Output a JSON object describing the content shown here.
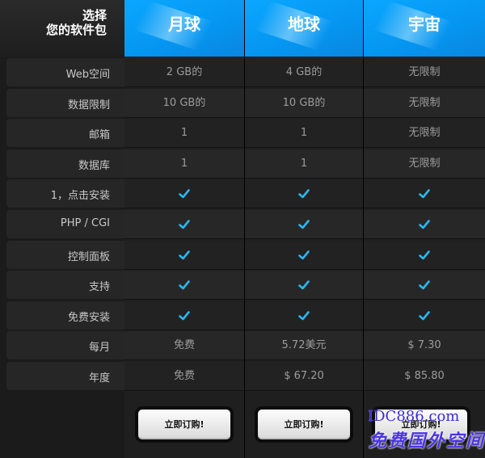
{
  "header": {
    "line1": "选择",
    "line2": "您的软件包",
    "plans": [
      "月球",
      "地球",
      "宇宙"
    ]
  },
  "rows": [
    {
      "label": "Web空间",
      "values": [
        "2 GB的",
        "4 GB的",
        "无限制"
      ]
    },
    {
      "label": "数据限制",
      "values": [
        "10 GB的",
        "10 GB的",
        "无限制"
      ]
    },
    {
      "label": "邮箱",
      "values": [
        "1",
        "1",
        "无限制"
      ]
    },
    {
      "label": "数据库",
      "values": [
        "1",
        "1",
        "无限制"
      ]
    },
    {
      "label": "1，点击安装",
      "checks": true
    },
    {
      "label": "PHP / CGI",
      "checks": true
    },
    {
      "label": "控制面板",
      "checks": true
    },
    {
      "label": "支持",
      "checks": true
    },
    {
      "label": "免费安装",
      "checks": true
    },
    {
      "label": "每月",
      "values": [
        "免费",
        "5.72美元",
        "$ 7.30"
      ]
    },
    {
      "label": "年度",
      "values": [
        "免费",
        "$ 67.20",
        "$ 85.80"
      ]
    }
  ],
  "buttons": {
    "order_label": "立即订购!"
  },
  "watermark": {
    "line1": "IDC886.com",
    "line2": "免费国外空间"
  },
  "colors": {
    "accent": "#0aa7ff",
    "check": "#2bb6f0"
  }
}
